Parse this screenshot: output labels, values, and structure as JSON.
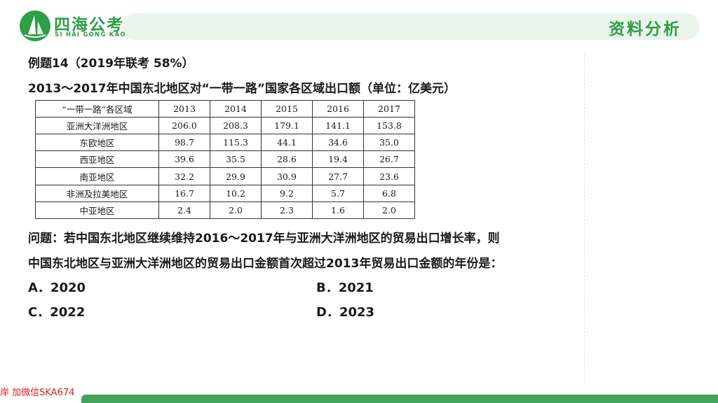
{
  "header": {
    "logo_cn": "四海公考",
    "logo_en": "SI HAI GONG KAO",
    "section_title": "资料分析"
  },
  "question": {
    "label": "例题14（2019年联考  58%）",
    "title": "2013～2017年中国东北地区对“一带一路”国家各区域出口额（单位：亿美元）",
    "prompt_line1": "问题：若中国东北地区继续维持2016～2017年与亚洲大洋洲地区的贸易出口增长率，则",
    "prompt_line2": "中国东北地区与亚洲大洋洲地区的贸易出口金额首次超过2013年贸易出口金额的年份是："
  },
  "table": {
    "headers": [
      "“一带一路”各区域",
      "2013",
      "2014",
      "2015",
      "2016",
      "2017"
    ],
    "rows": [
      [
        "亚洲大洋洲地区",
        "206.0",
        "208.3",
        "179.1",
        "141.1",
        "153.8"
      ],
      [
        "东欧地区",
        "98.7",
        "115.3",
        "44.1",
        "34.6",
        "35.0"
      ],
      [
        "西亚地区",
        "39.6",
        "35.5",
        "28.6",
        "19.4",
        "26.7"
      ],
      [
        "南亚地区",
        "32.2",
        "29.9",
        "30.9",
        "27.7",
        "23.6"
      ],
      [
        "非洲及拉美地区",
        "16.7",
        "10.2",
        "9.2",
        "5.7",
        "6.8"
      ],
      [
        "中亚地区",
        "2.4",
        "2.0",
        "2.3",
        "1.6",
        "2.0"
      ]
    ]
  },
  "options": {
    "a": "A．2020",
    "b": "B．2021",
    "c": "C．2022",
    "d": "D．2023"
  },
  "watermark": "岸 加微信SKA674",
  "colors": {
    "brand_green": "#2e9e47",
    "header_bg": "#eaf5ec",
    "watermark_red": "#d81e1e"
  }
}
